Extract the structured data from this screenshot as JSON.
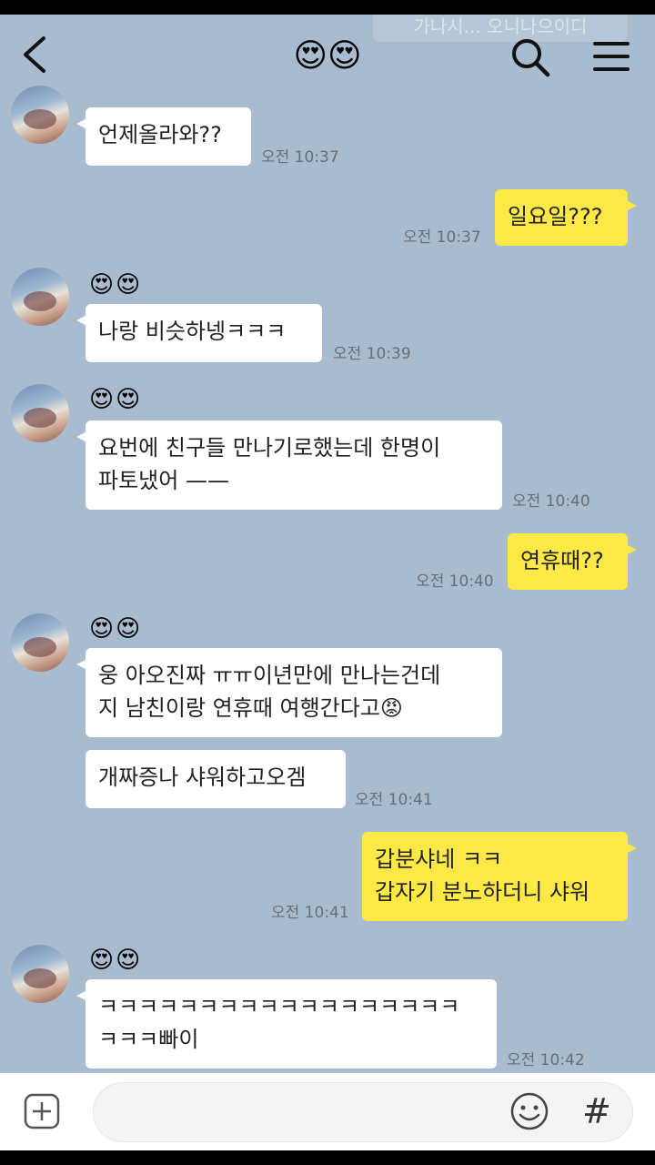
{
  "header": {
    "title_emoji": "😍😍",
    "faded_banner": "가나시... 오니나으이디",
    "icons": {
      "back": "chevron-left-icon",
      "search": "search-icon",
      "menu": "hamburger-menu-icon"
    }
  },
  "messages": [
    {
      "side": "in",
      "sender": "😍😍",
      "text": "언제올라와??",
      "time": "오전 10:37"
    },
    {
      "side": "out",
      "text": "일요일???",
      "time": "오전 10:37"
    },
    {
      "side": "in",
      "sender": "😍😍",
      "text": "나랑 비슷하넹ㅋㅋㅋ",
      "time": "오전 10:39"
    },
    {
      "side": "in",
      "sender": "😍😍",
      "text": "요번에 친구들 만나기로했는데 한명이\n파토냈어 ——",
      "time": "오전 10:40"
    },
    {
      "side": "out",
      "text": "연휴때??",
      "time": "오전 10:40"
    },
    {
      "side": "in",
      "sender": "😍😍",
      "text": "웅 아오진짜 ㅠㅠ이년만에 만나는건데\n지 남친이랑 연휴때 여행간다고😡"
    },
    {
      "side": "in",
      "text": "개짜증나 샤워하고오겜",
      "time": "오전 10:41"
    },
    {
      "side": "out",
      "text": "갑분샤네 ㅋㅋ\n갑자기 분노하더니 샤워",
      "time": "오전 10:41"
    },
    {
      "side": "in",
      "sender": "😍😍",
      "text": "ㅋㅋㅋㅋㅋㅋㅋㅋㅋㅋㅋㅋㅋㅋㅋㅋㅋㅋ\nㅋㅋㅋ빠이",
      "time": "오전 10:42"
    }
  ],
  "composer": {
    "placeholder": "",
    "icons": {
      "plus": "plus-square-icon",
      "emoji": "smiley-icon",
      "hash": "hash-icon"
    },
    "hash_glyph": "#"
  },
  "colors": {
    "background": "#a9bccf",
    "bubble_in": "#ffffff",
    "bubble_out": "#fde945"
  }
}
